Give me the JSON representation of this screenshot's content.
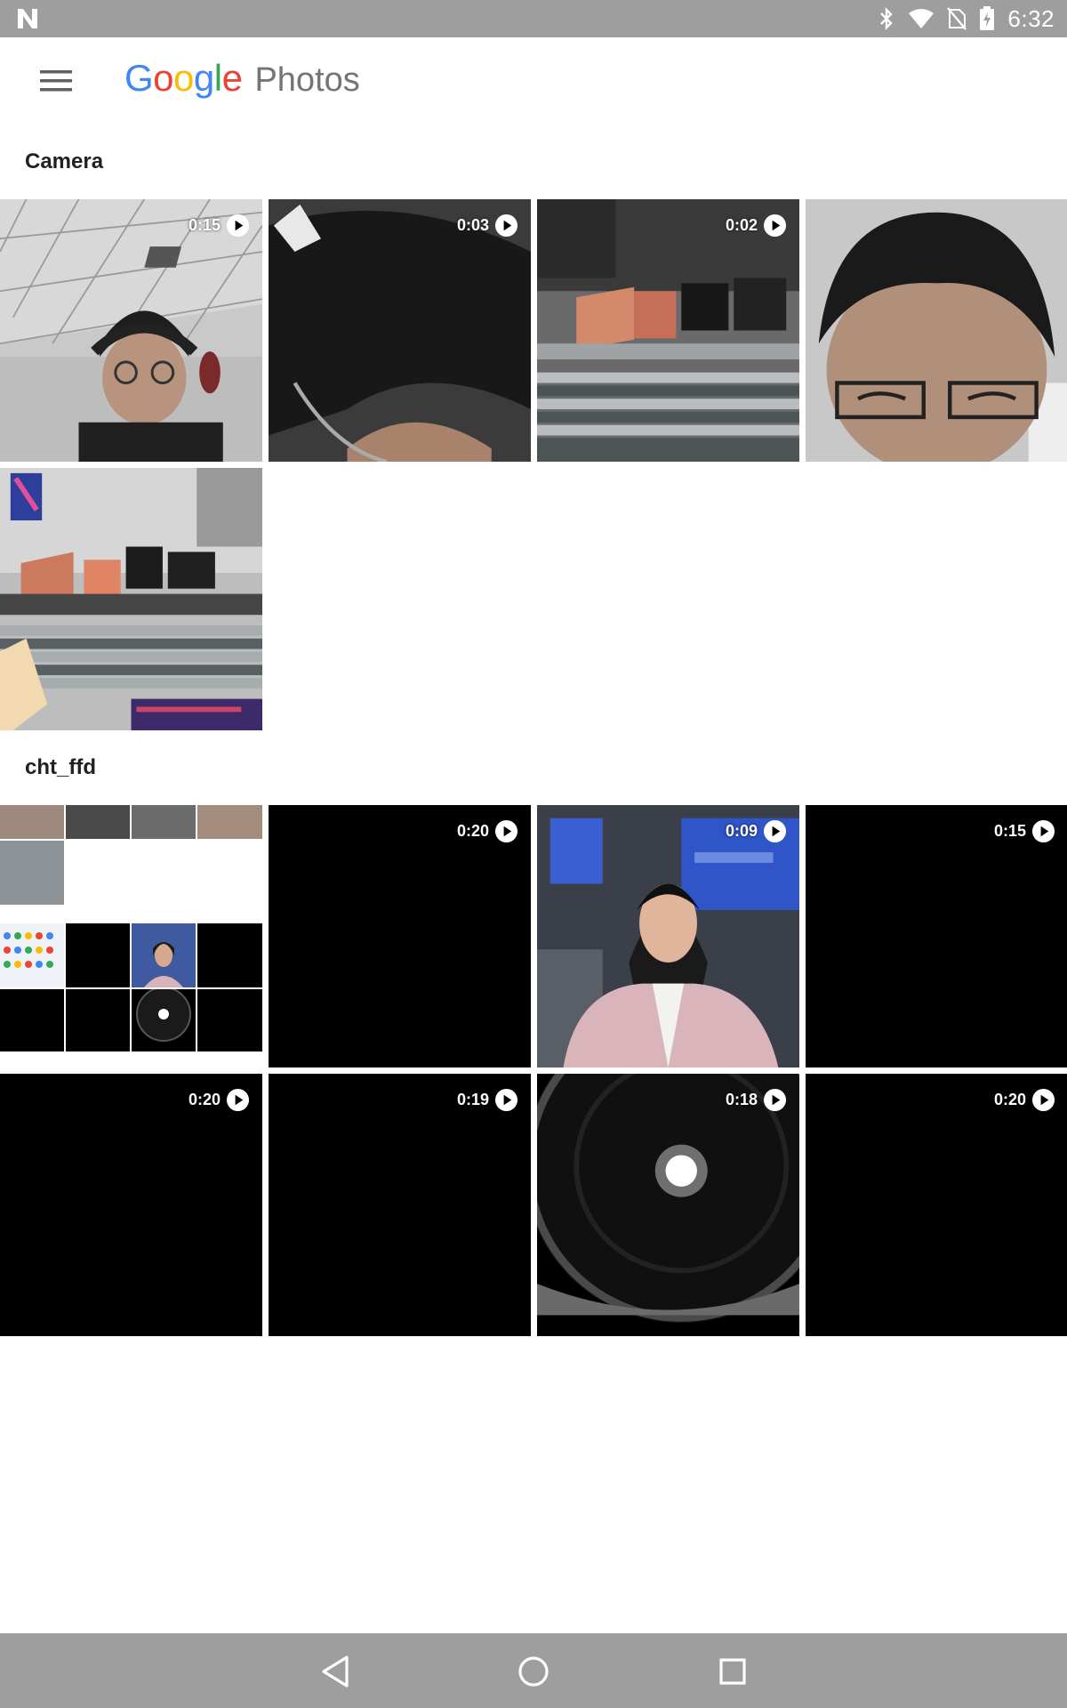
{
  "status_bar": {
    "time": "6:32",
    "icons": [
      "notification-n-icon",
      "bluetooth-icon",
      "wifi-icon",
      "no-sim-icon",
      "battery-charging-icon"
    ]
  },
  "app_bar": {
    "brand_letters": [
      {
        "char": "G",
        "color": "#4285F4"
      },
      {
        "char": "o",
        "color": "#EA4335"
      },
      {
        "char": "o",
        "color": "#FBBC05"
      },
      {
        "char": "g",
        "color": "#4285F4"
      },
      {
        "char": "l",
        "color": "#34A853"
      },
      {
        "char": "e",
        "color": "#EA4335"
      }
    ],
    "product_name": "Photos",
    "menu_icon": "menu-icon"
  },
  "sections": [
    {
      "title": "Camera",
      "items": [
        {
          "type": "video",
          "duration": "0:15",
          "scene": "selfie-headphones"
        },
        {
          "type": "video",
          "duration": "0:03",
          "scene": "hair-closeup"
        },
        {
          "type": "video",
          "duration": "0:02",
          "scene": "office-monitors"
        },
        {
          "type": "photo",
          "scene": "selfie-glasses"
        },
        {
          "type": "photo",
          "scene": "office-desks"
        }
      ]
    },
    {
      "title": "cht_ffd",
      "items": [
        {
          "type": "screenshot",
          "scene": "collage"
        },
        {
          "type": "video",
          "duration": "0:20",
          "scene": "black"
        },
        {
          "type": "video",
          "duration": "0:09",
          "scene": "news-anchor"
        },
        {
          "type": "video",
          "duration": "0:15",
          "scene": "black"
        },
        {
          "type": "video",
          "duration": "0:20",
          "scene": "black"
        },
        {
          "type": "video",
          "duration": "0:19",
          "scene": "black"
        },
        {
          "type": "video",
          "duration": "0:18",
          "scene": "lens-light"
        },
        {
          "type": "video",
          "duration": "0:20",
          "scene": "black"
        }
      ]
    }
  ],
  "nav_bar": {
    "buttons": [
      "back-icon",
      "home-icon",
      "recents-icon"
    ]
  },
  "colors": {
    "status_bar": "#9e9e9e",
    "nav_bar": "#9e9e9e",
    "section_title": "#212121",
    "product_name": "#757575"
  }
}
